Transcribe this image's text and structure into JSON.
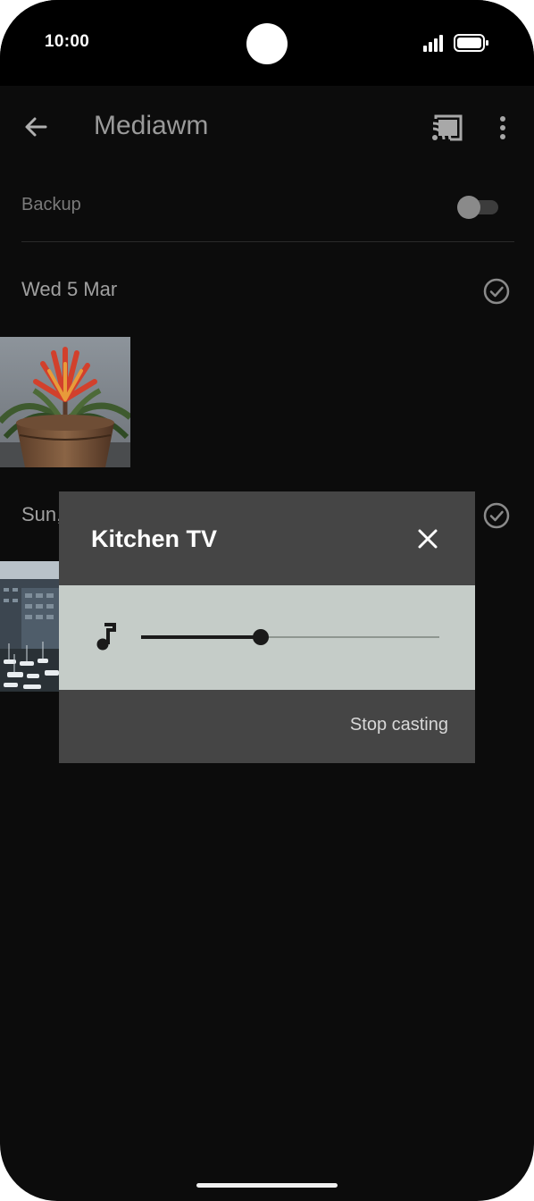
{
  "status_bar": {
    "time": "10:00",
    "icons": [
      "signal-icon",
      "battery-icon"
    ]
  },
  "app_bar": {
    "title": "Mediawm",
    "back_icon": "arrow-back-icon",
    "actions": [
      "cast-icon",
      "more-vert-icon"
    ]
  },
  "backup": {
    "label": "Backup",
    "enabled": false
  },
  "sections": [
    {
      "date": "Wed 5 Mar",
      "icon": "check-circle-icon",
      "photos": [
        "plant-photo"
      ]
    },
    {
      "date": "Sun,",
      "icon": "check-circle-icon",
      "photos": [
        "harbor-photo"
      ]
    }
  ],
  "cast_dialog": {
    "title": "Kitchen TV",
    "close_icon": "close-icon",
    "volume_icon": "music-note-icon",
    "volume_level": 0.4,
    "stop_label": "Stop casting"
  },
  "colors": {
    "background": "#0c0c0c",
    "dialog": "#454545",
    "volume_row": "#c5ccc8",
    "text_muted": "#9a9a9a"
  }
}
